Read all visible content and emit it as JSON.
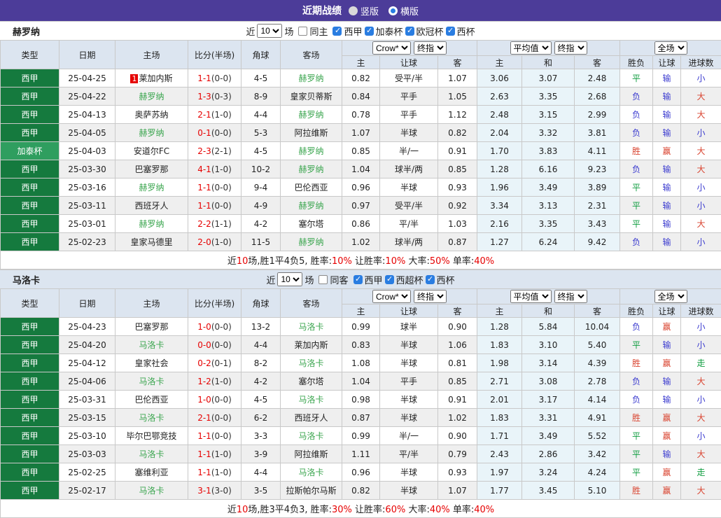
{
  "colors": {
    "purple": "#4c3c99",
    "liga_green": "#157a3e",
    "cup_green": "#2f9e5f",
    "team_green": "#3aa54e",
    "red": "#e60000",
    "result_blue": "#3b3bcf",
    "result_green": "#0f9d3f",
    "header_bg": "#dce5f0"
  },
  "title_bar": {
    "title": "近期战绩",
    "radios": [
      {
        "label": "竖版",
        "selected": false
      },
      {
        "label": "横版",
        "selected": true
      }
    ]
  },
  "table_columns": {
    "left": [
      "类型",
      "日期",
      "主场",
      "比分(半场)",
      "角球",
      "客场"
    ],
    "groups": [
      {
        "selects": [
          "Crow*",
          "终指"
        ],
        "subs": [
          "主",
          "让球",
          "客"
        ]
      },
      {
        "selects": [
          "平均值",
          "终指"
        ],
        "subs": [
          "主",
          "和",
          "客"
        ]
      },
      {
        "selects": [
          "全场"
        ],
        "subs": [
          "胜负",
          "让球",
          "进球数"
        ]
      }
    ]
  },
  "sections": [
    {
      "team": "赫罗纳",
      "band_alt": false,
      "filter": {
        "prefix": "近",
        "count": "10",
        "suffix": "场",
        "same_label": "同主",
        "same_checked": false,
        "leagues": [
          {
            "label": "西甲",
            "checked": true
          },
          {
            "label": "加泰杯",
            "checked": true
          },
          {
            "label": "欧冠杯",
            "checked": true
          },
          {
            "label": "西杯",
            "checked": true
          }
        ]
      },
      "rows": [
        {
          "type": "西甲",
          "type_style": "liga",
          "date": "25-04-25",
          "home": "莱加内斯",
          "home_green": false,
          "home_badge": "1",
          "score": "1-1",
          "half": "(0-0)",
          "corner": "4-5",
          "away": "赫罗纳",
          "away_green": true,
          "o1": "0.82",
          "o2": "受平/半",
          "o3": "1.07",
          "a1": "3.06",
          "a2": "3.07",
          "a3": "2.48",
          "r1": {
            "t": "平",
            "c": "g"
          },
          "r2": {
            "t": "输",
            "c": "b"
          },
          "r3": {
            "t": "小",
            "c": "b"
          }
        },
        {
          "type": "西甲",
          "type_style": "liga",
          "date": "25-04-22",
          "home": "赫罗纳",
          "home_green": true,
          "home_badge": null,
          "score": "1-3",
          "half": "(0-3)",
          "corner": "8-9",
          "away": "皇家贝蒂斯",
          "away_green": false,
          "o1": "0.84",
          "o2": "平手",
          "o3": "1.05",
          "a1": "2.63",
          "a2": "3.35",
          "a3": "2.68",
          "r1": {
            "t": "负",
            "c": "b"
          },
          "r2": {
            "t": "输",
            "c": "b"
          },
          "r3": {
            "t": "大",
            "c": "r"
          }
        },
        {
          "type": "西甲",
          "type_style": "liga",
          "date": "25-04-13",
          "home": "奥萨苏纳",
          "home_green": false,
          "home_badge": null,
          "score": "2-1",
          "half": "(1-0)",
          "corner": "4-4",
          "away": "赫罗纳",
          "away_green": true,
          "o1": "0.78",
          "o2": "平手",
          "o3": "1.12",
          "a1": "2.48",
          "a2": "3.15",
          "a3": "2.99",
          "r1": {
            "t": "负",
            "c": "b"
          },
          "r2": {
            "t": "输",
            "c": "b"
          },
          "r3": {
            "t": "大",
            "c": "r"
          }
        },
        {
          "type": "西甲",
          "type_style": "liga",
          "date": "25-04-05",
          "home": "赫罗纳",
          "home_green": true,
          "home_badge": null,
          "score": "0-1",
          "half": "(0-0)",
          "corner": "5-3",
          "away": "阿拉维斯",
          "away_green": false,
          "o1": "1.07",
          "o2": "半球",
          "o3": "0.82",
          "a1": "2.04",
          "a2": "3.32",
          "a3": "3.81",
          "r1": {
            "t": "负",
            "c": "b"
          },
          "r2": {
            "t": "输",
            "c": "b"
          },
          "r3": {
            "t": "小",
            "c": "b"
          }
        },
        {
          "type": "加泰杯",
          "type_style": "cup",
          "date": "25-04-03",
          "home": "安道尔FC",
          "home_green": false,
          "home_badge": null,
          "score": "2-3",
          "half": "(2-1)",
          "corner": "4-5",
          "away": "赫罗纳",
          "away_green": true,
          "o1": "0.85",
          "o2": "半/一",
          "o3": "0.91",
          "a1": "1.70",
          "a2": "3.83",
          "a3": "4.11",
          "r1": {
            "t": "胜",
            "c": "r"
          },
          "r2": {
            "t": "赢",
            "c": "r"
          },
          "r3": {
            "t": "大",
            "c": "r"
          }
        },
        {
          "type": "西甲",
          "type_style": "liga",
          "date": "25-03-30",
          "home": "巴塞罗那",
          "home_green": false,
          "home_badge": null,
          "score": "4-1",
          "half": "(1-0)",
          "corner": "10-2",
          "away": "赫罗纳",
          "away_green": true,
          "o1": "1.04",
          "o2": "球半/两",
          "o3": "0.85",
          "a1": "1.28",
          "a2": "6.16",
          "a3": "9.23",
          "r1": {
            "t": "负",
            "c": "b"
          },
          "r2": {
            "t": "输",
            "c": "b"
          },
          "r3": {
            "t": "大",
            "c": "r"
          }
        },
        {
          "type": "西甲",
          "type_style": "liga",
          "date": "25-03-16",
          "home": "赫罗纳",
          "home_green": true,
          "home_badge": null,
          "score": "1-1",
          "half": "(0-0)",
          "corner": "9-4",
          "away": "巴伦西亚",
          "away_green": false,
          "o1": "0.96",
          "o2": "半球",
          "o3": "0.93",
          "a1": "1.96",
          "a2": "3.49",
          "a3": "3.89",
          "r1": {
            "t": "平",
            "c": "g"
          },
          "r2": {
            "t": "输",
            "c": "b"
          },
          "r3": {
            "t": "小",
            "c": "b"
          }
        },
        {
          "type": "西甲",
          "type_style": "liga",
          "date": "25-03-11",
          "home": "西班牙人",
          "home_green": false,
          "home_badge": null,
          "score": "1-1",
          "half": "(0-0)",
          "corner": "4-9",
          "away": "赫罗纳",
          "away_green": true,
          "o1": "0.97",
          "o2": "受平/半",
          "o3": "0.92",
          "a1": "3.34",
          "a2": "3.13",
          "a3": "2.31",
          "r1": {
            "t": "平",
            "c": "g"
          },
          "r2": {
            "t": "输",
            "c": "b"
          },
          "r3": {
            "t": "小",
            "c": "b"
          }
        },
        {
          "type": "西甲",
          "type_style": "liga",
          "date": "25-03-01",
          "home": "赫罗纳",
          "home_green": true,
          "home_badge": null,
          "score": "2-2",
          "half": "(1-1)",
          "corner": "4-2",
          "away": "塞尔塔",
          "away_green": false,
          "o1": "0.86",
          "o2": "平/半",
          "o3": "1.03",
          "a1": "2.16",
          "a2": "3.35",
          "a3": "3.43",
          "r1": {
            "t": "平",
            "c": "g"
          },
          "r2": {
            "t": "输",
            "c": "b"
          },
          "r3": {
            "t": "大",
            "c": "r"
          }
        },
        {
          "type": "西甲",
          "type_style": "liga",
          "date": "25-02-23",
          "home": "皇家马德里",
          "home_green": false,
          "home_badge": null,
          "score": "2-0",
          "half": "(1-0)",
          "corner": "11-5",
          "away": "赫罗纳",
          "away_green": true,
          "o1": "1.02",
          "o2": "球半/两",
          "o3": "0.87",
          "a1": "1.27",
          "a2": "6.24",
          "a3": "9.42",
          "r1": {
            "t": "负",
            "c": "b"
          },
          "r2": {
            "t": "输",
            "c": "b"
          },
          "r3": {
            "t": "小",
            "c": "b"
          }
        }
      ],
      "summary": [
        {
          "t": "近"
        },
        {
          "t": "10",
          "red": true
        },
        {
          "t": "场,胜1平4负5, 胜率:"
        },
        {
          "t": "10%",
          "red": true
        },
        {
          "t": " 让胜率:"
        },
        {
          "t": "10%",
          "red": true
        },
        {
          "t": " 大率:"
        },
        {
          "t": "50%",
          "red": true
        },
        {
          "t": " 单率:"
        },
        {
          "t": "40%",
          "red": true
        }
      ]
    },
    {
      "team": "马洛卡",
      "band_alt": true,
      "filter": {
        "prefix": "近",
        "count": "10",
        "suffix": "场",
        "same_label": "同客",
        "same_checked": false,
        "leagues": [
          {
            "label": "西甲",
            "checked": true
          },
          {
            "label": "西超杯",
            "checked": true
          },
          {
            "label": "西杯",
            "checked": true
          }
        ]
      },
      "rows": [
        {
          "type": "西甲",
          "type_style": "liga",
          "date": "25-04-23",
          "home": "巴塞罗那",
          "home_green": false,
          "home_badge": null,
          "score": "1-0",
          "half": "(0-0)",
          "corner": "13-2",
          "away": "马洛卡",
          "away_green": true,
          "o1": "0.99",
          "o2": "球半",
          "o3": "0.90",
          "a1": "1.28",
          "a2": "5.84",
          "a3": "10.04",
          "r1": {
            "t": "负",
            "c": "b"
          },
          "r2": {
            "t": "赢",
            "c": "r"
          },
          "r3": {
            "t": "小",
            "c": "b"
          }
        },
        {
          "type": "西甲",
          "type_style": "liga",
          "date": "25-04-20",
          "home": "马洛卡",
          "home_green": true,
          "home_badge": null,
          "score": "0-0",
          "half": "(0-0)",
          "corner": "4-4",
          "away": "莱加内斯",
          "away_green": false,
          "o1": "0.83",
          "o2": "半球",
          "o3": "1.06",
          "a1": "1.83",
          "a2": "3.10",
          "a3": "5.40",
          "r1": {
            "t": "平",
            "c": "g"
          },
          "r2": {
            "t": "输",
            "c": "b"
          },
          "r3": {
            "t": "小",
            "c": "b"
          }
        },
        {
          "type": "西甲",
          "type_style": "liga",
          "date": "25-04-12",
          "home": "皇家社会",
          "home_green": false,
          "home_badge": null,
          "score": "0-2",
          "half": "(0-1)",
          "corner": "8-2",
          "away": "马洛卡",
          "away_green": true,
          "o1": "1.08",
          "o2": "半球",
          "o3": "0.81",
          "a1": "1.98",
          "a2": "3.14",
          "a3": "4.39",
          "r1": {
            "t": "胜",
            "c": "r"
          },
          "r2": {
            "t": "赢",
            "c": "r"
          },
          "r3": {
            "t": "走",
            "c": "g"
          }
        },
        {
          "type": "西甲",
          "type_style": "liga",
          "date": "25-04-06",
          "home": "马洛卡",
          "home_green": true,
          "home_badge": null,
          "score": "1-2",
          "half": "(1-0)",
          "corner": "4-2",
          "away": "塞尔塔",
          "away_green": false,
          "o1": "1.04",
          "o2": "平手",
          "o3": "0.85",
          "a1": "2.71",
          "a2": "3.08",
          "a3": "2.78",
          "r1": {
            "t": "负",
            "c": "b"
          },
          "r2": {
            "t": "输",
            "c": "b"
          },
          "r3": {
            "t": "大",
            "c": "r"
          }
        },
        {
          "type": "西甲",
          "type_style": "liga",
          "date": "25-03-31",
          "home": "巴伦西亚",
          "home_green": false,
          "home_badge": null,
          "score": "1-0",
          "half": "(0-0)",
          "corner": "4-5",
          "away": "马洛卡",
          "away_green": true,
          "o1": "0.98",
          "o2": "半球",
          "o3": "0.91",
          "a1": "2.01",
          "a2": "3.17",
          "a3": "4.14",
          "r1": {
            "t": "负",
            "c": "b"
          },
          "r2": {
            "t": "输",
            "c": "b"
          },
          "r3": {
            "t": "小",
            "c": "b"
          }
        },
        {
          "type": "西甲",
          "type_style": "liga",
          "date": "25-03-15",
          "home": "马洛卡",
          "home_green": true,
          "home_badge": null,
          "score": "2-1",
          "half": "(0-0)",
          "corner": "6-2",
          "away": "西班牙人",
          "away_green": false,
          "o1": "0.87",
          "o2": "半球",
          "o3": "1.02",
          "a1": "1.83",
          "a2": "3.31",
          "a3": "4.91",
          "r1": {
            "t": "胜",
            "c": "r"
          },
          "r2": {
            "t": "赢",
            "c": "r"
          },
          "r3": {
            "t": "大",
            "c": "r"
          }
        },
        {
          "type": "西甲",
          "type_style": "liga",
          "date": "25-03-10",
          "home": "毕尔巴鄂竞技",
          "home_green": false,
          "home_badge": null,
          "score": "1-1",
          "half": "(0-0)",
          "corner": "3-3",
          "away": "马洛卡",
          "away_green": true,
          "o1": "0.99",
          "o2": "半/一",
          "o3": "0.90",
          "a1": "1.71",
          "a2": "3.49",
          "a3": "5.52",
          "r1": {
            "t": "平",
            "c": "g"
          },
          "r2": {
            "t": "赢",
            "c": "r"
          },
          "r3": {
            "t": "小",
            "c": "b"
          }
        },
        {
          "type": "西甲",
          "type_style": "liga",
          "date": "25-03-03",
          "home": "马洛卡",
          "home_green": true,
          "home_badge": null,
          "score": "1-1",
          "half": "(1-0)",
          "corner": "3-9",
          "away": "阿拉维斯",
          "away_green": false,
          "o1": "1.11",
          "o2": "平/半",
          "o3": "0.79",
          "a1": "2.43",
          "a2": "2.86",
          "a3": "3.42",
          "r1": {
            "t": "平",
            "c": "g"
          },
          "r2": {
            "t": "输",
            "c": "b"
          },
          "r3": {
            "t": "大",
            "c": "r"
          }
        },
        {
          "type": "西甲",
          "type_style": "liga",
          "date": "25-02-25",
          "home": "塞维利亚",
          "home_green": false,
          "home_badge": null,
          "score": "1-1",
          "half": "(1-0)",
          "corner": "4-4",
          "away": "马洛卡",
          "away_green": true,
          "o1": "0.96",
          "o2": "半球",
          "o3": "0.93",
          "a1": "1.97",
          "a2": "3.24",
          "a3": "4.24",
          "r1": {
            "t": "平",
            "c": "g"
          },
          "r2": {
            "t": "赢",
            "c": "r"
          },
          "r3": {
            "t": "走",
            "c": "g"
          }
        },
        {
          "type": "西甲",
          "type_style": "liga",
          "date": "25-02-17",
          "home": "马洛卡",
          "home_green": true,
          "home_badge": null,
          "score": "3-1",
          "half": "(3-0)",
          "corner": "3-5",
          "away": "拉斯帕尔马斯",
          "away_green": false,
          "o1": "0.82",
          "o2": "半球",
          "o3": "1.07",
          "a1": "1.77",
          "a2": "3.45",
          "a3": "5.10",
          "r1": {
            "t": "胜",
            "c": "r"
          },
          "r2": {
            "t": "赢",
            "c": "r"
          },
          "r3": {
            "t": "大",
            "c": "r"
          }
        }
      ],
      "summary": [
        {
          "t": "近"
        },
        {
          "t": "10",
          "red": true
        },
        {
          "t": "场,胜3平4负3, 胜率:"
        },
        {
          "t": "30%",
          "red": true
        },
        {
          "t": " 让胜率:"
        },
        {
          "t": "60%",
          "red": true
        },
        {
          "t": " 大率:"
        },
        {
          "t": "40%",
          "red": true
        },
        {
          "t": " 单率:"
        },
        {
          "t": "40%",
          "red": true
        }
      ]
    }
  ]
}
